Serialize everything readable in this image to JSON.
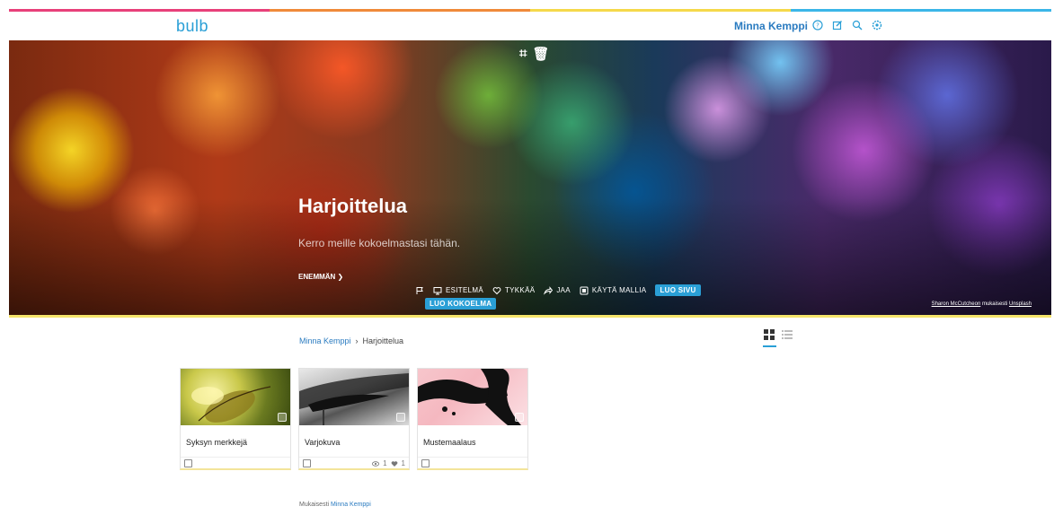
{
  "brand": {
    "logo": "bulb",
    "stripe_colors": [
      "#e8407a",
      "#f08a3a",
      "#f5d94a",
      "#3bb6e8"
    ],
    "accent": "#2a9fd6"
  },
  "topbar": {
    "user_name": "Minna Kemppi",
    "icons": [
      "help-icon",
      "edit-icon",
      "search-icon",
      "settings-icon"
    ]
  },
  "hero": {
    "title": "Harjoittelua",
    "description": "Kerro meille kokoelmastasi tähän.",
    "more_label": "ENEMMÄN ❯",
    "tools": [
      "crop-icon",
      "trash-icon"
    ],
    "actions": {
      "present": "ESITELMÄ",
      "like": "TYKKÄÄ",
      "share": "JAA",
      "use_template": "KÄYTÄ MALLIA",
      "create_page": "LUO SIVU",
      "create_collection": "LUO KOKOELMA"
    },
    "credit_author": "Sharon McCutcheon",
    "credit_mid": " mukaisesti ",
    "credit_source": "Unsplash"
  },
  "breadcrumb": {
    "owner": "Minna Kemppi",
    "separator": "›",
    "current": "Harjoittelua"
  },
  "cards": [
    {
      "title": "Syksyn merkkejä",
      "views": "",
      "likes": ""
    },
    {
      "title": "Varjokuva",
      "views": "1",
      "likes": "1"
    },
    {
      "title": "Mustemaalaus",
      "views": "",
      "likes": ""
    }
  ],
  "footer": {
    "prefix": "Mukaisesti ",
    "author": "Minna Kemppi"
  }
}
